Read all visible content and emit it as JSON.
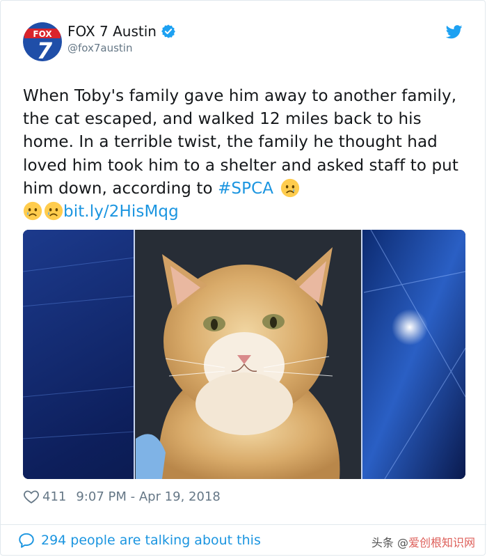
{
  "account": {
    "name": "FOX 7 Austin",
    "handle": "@fox7austin",
    "logo_text_top": "FOX",
    "logo_text_num": "7",
    "verified_icon": "verified-badge-icon"
  },
  "tweet": {
    "text_main": "When Toby's family gave him away to another family, the cat escaped, and walked 12 miles back to his home. In a terrible twist, the family he thought had loved him took him to a shelter and asked staff to put him down, according to ",
    "hashtag": "#SPCA",
    "link": "bit.ly/2HisMqg",
    "emoji": "crying-face-emoji"
  },
  "media": {
    "alt": "orange and white long-haired cat"
  },
  "meta": {
    "likes": "411",
    "timestamp": "9:07 PM - Apr 19, 2018"
  },
  "footer": {
    "talking": "294 people are talking about this"
  },
  "watermark": {
    "prefix": "头条 @",
    "brand": "爱创根知识网"
  },
  "colors": {
    "link": "#1b95e0",
    "secondary_text": "#657786",
    "fox_red": "#d9242b",
    "fox_blue": "#1f4ea8"
  }
}
